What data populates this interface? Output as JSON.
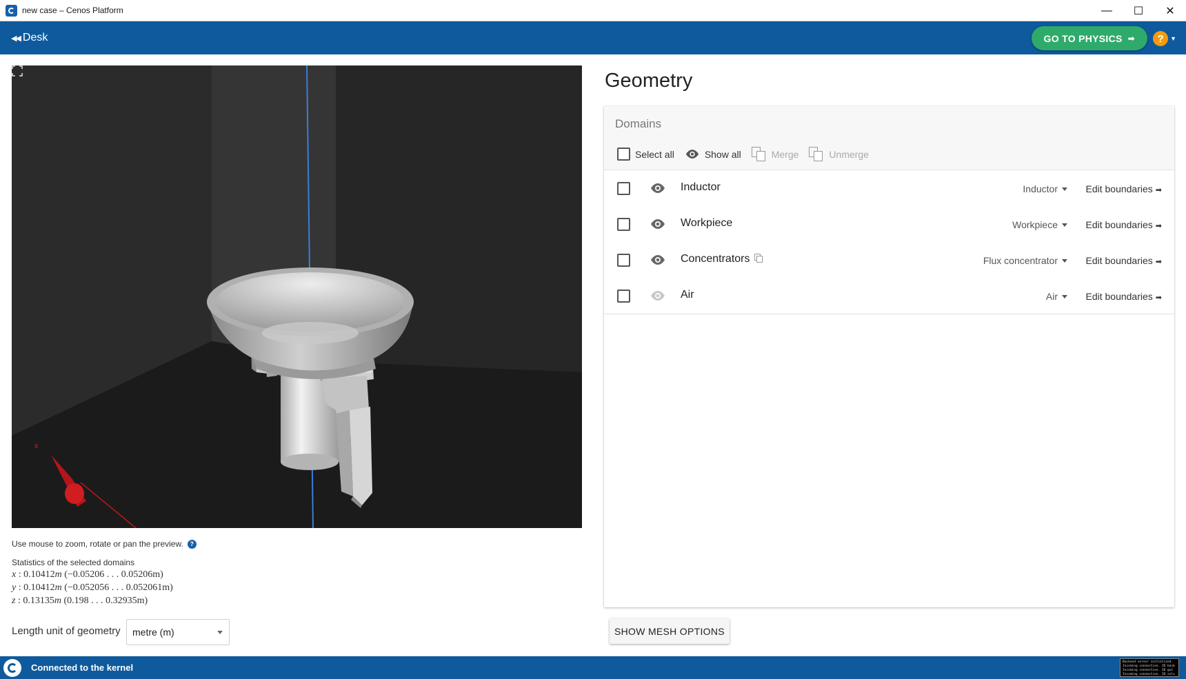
{
  "window": {
    "title": "new case – Cenos Platform",
    "controls": {
      "minimize": "—",
      "maximize": "☐",
      "close": "✕"
    }
  },
  "header": {
    "desk_label": "Desk",
    "physics_button": "GO TO PHYSICS",
    "help_label": "?"
  },
  "viewport": {
    "axis_label": "x",
    "hint": "Use mouse to zoom, rotate or pan the preview.",
    "hint_icon": "?"
  },
  "stats": {
    "title": "Statistics of the selected domains",
    "x": {
      "axis": "x",
      "length": "0.10412",
      "unit": "m",
      "range": "(−0.05206 . . . 0.05206m)"
    },
    "y": {
      "axis": "y",
      "length": "0.10412",
      "unit": "m",
      "range": "(−0.052056 . . . 0.052061m)"
    },
    "z": {
      "axis": "z",
      "length": "0.13135",
      "unit": "m",
      "range": "(0.198 . . . 0.32935m)"
    }
  },
  "units": {
    "label": "Length unit of geometry",
    "selected": "metre (m)"
  },
  "geometry": {
    "title": "Geometry",
    "domains_title": "Domains",
    "toolbar": {
      "select_all": "Select all",
      "show_all": "Show all",
      "merge": "Merge",
      "unmerge": "Unmerge"
    },
    "domains": [
      {
        "name": "Inductor",
        "type": "Inductor",
        "edit": "Edit boundaries",
        "visible": true,
        "merged": false
      },
      {
        "name": "Workpiece",
        "type": "Workpiece",
        "edit": "Edit boundaries",
        "visible": true,
        "merged": false
      },
      {
        "name": "Concentrators",
        "type": "Flux concentrator",
        "edit": "Edit boundaries",
        "visible": true,
        "merged": true
      },
      {
        "name": "Air",
        "type": "Air",
        "edit": "Edit boundaries",
        "visible": false,
        "merged": false
      }
    ],
    "mesh_button": "SHOW MESH OPTIONS"
  },
  "status": {
    "text": "Connected to the kernel",
    "console_lines": [
      "Backend server initialized.",
      "Incoming connection. ID back",
      "Incoming connection. ID gui",
      "Incoming connection. ID solv"
    ]
  },
  "colors": {
    "primary": "#0e5a9c",
    "accent_green": "#2eab6a",
    "help_orange": "#f39c12",
    "viewport_bg": "#202020",
    "axis_blue": "#3a7fd8",
    "axis_red": "#c0171a"
  }
}
